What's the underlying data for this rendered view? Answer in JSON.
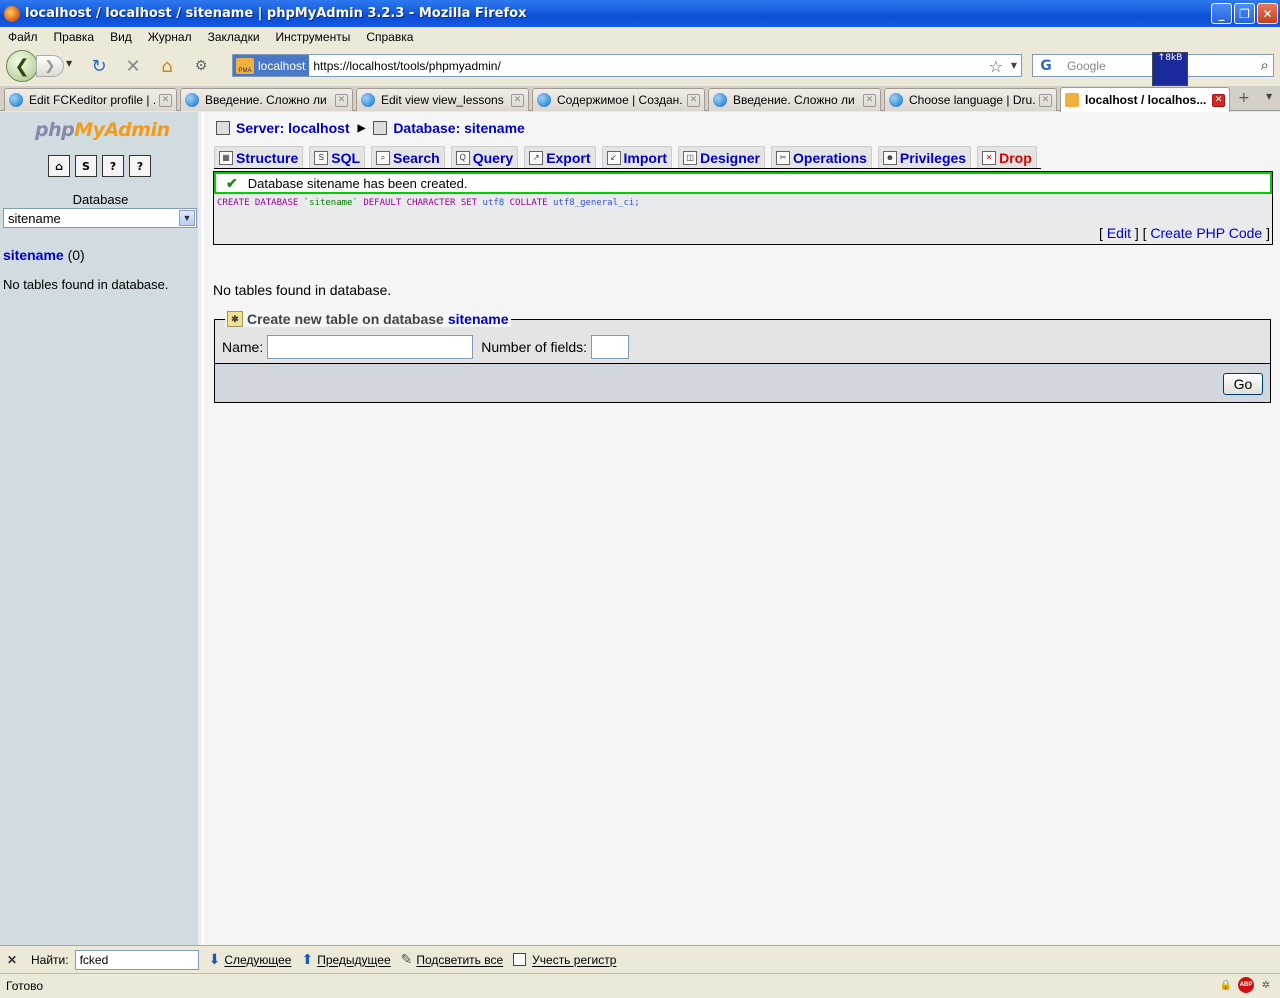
{
  "window": {
    "title": "localhost / localhost / sitename | phpMyAdmin 3.2.3 - Mozilla Firefox"
  },
  "menu": [
    "Файл",
    "Правка",
    "Вид",
    "Журнал",
    "Закладки",
    "Инструменты",
    "Справка"
  ],
  "nav": {
    "site_badge": "localhost",
    "url": "https://localhost/tools/phpmyadmin/",
    "search_placeholder": "Google",
    "net_widget": "↑8kB"
  },
  "tabs": [
    {
      "label": "Edit FCKeditor profile | ...",
      "icon": "drupal-icon"
    },
    {
      "label": "Введение. Сложно ли ...",
      "icon": "drupal-icon"
    },
    {
      "label": "Edit view view_lessons ...",
      "icon": "drupal-icon"
    },
    {
      "label": "Содержимое | Создан...",
      "icon": "drupal-icon"
    },
    {
      "label": "Введение. Сложно ли ...",
      "icon": "drupal-icon"
    },
    {
      "label": "Choose language | Dru...",
      "icon": "drupal-icon"
    },
    {
      "label": "localhost / localhos...",
      "icon": "pma-icon",
      "active": true
    }
  ],
  "left": {
    "logo_php": "php",
    "logo_my": "My",
    "logo_admin": "Admin",
    "db_label": "Database",
    "db_selected": "sitename",
    "db_name": "sitename",
    "db_count": "(0)",
    "no_tables": "No tables found in database."
  },
  "main": {
    "server_crumb": "Server: localhost",
    "db_crumb": "Database: sitename",
    "tabs": [
      "Structure",
      "SQL",
      "Search",
      "Query",
      "Export",
      "Import",
      "Designer",
      "Operations",
      "Privileges",
      "Drop"
    ],
    "success_msg": "Database sitename has been created.",
    "sql": {
      "kw1": "CREATE DATABASE",
      "ident": "`sitename`",
      "kw2": "DEFAULT CHARACTER SET",
      "charset": "utf8",
      "kw3": "COLLATE",
      "collation": "utf8_general_ci;"
    },
    "edit_link": "Edit",
    "php_link": "Create PHP Code",
    "no_tables": "No tables found in database.",
    "create_legend": "Create new table on database",
    "create_db": "sitename",
    "name_label": "Name:",
    "fields_label": "Number of fields:",
    "go_label": "Go"
  },
  "findbar": {
    "label": "Найти:",
    "value": "fcked",
    "next": "Следующее",
    "prev": "Предыдущее",
    "highlight": "Подсветить все",
    "match_case": "Учесть регистр"
  },
  "status": {
    "text": "Готово"
  }
}
